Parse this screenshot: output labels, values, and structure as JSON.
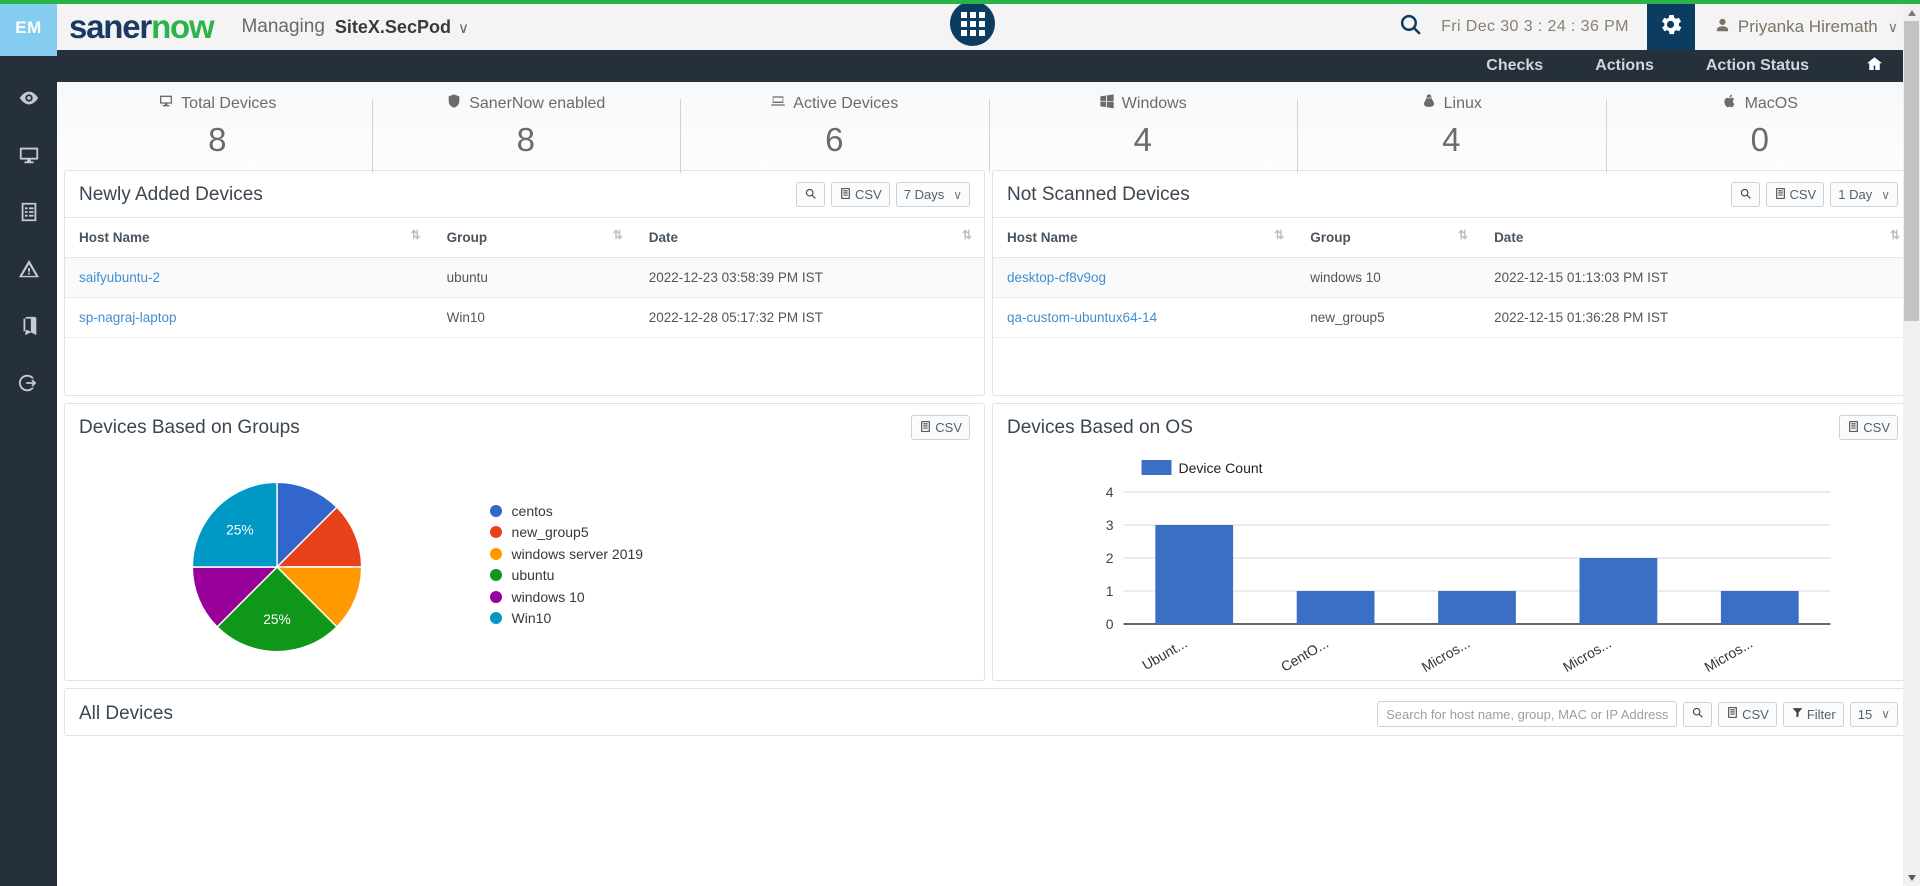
{
  "brand": {
    "part1": "saner",
    "part2": "now"
  },
  "header": {
    "managing_label": "Managing",
    "site": "SiteX.SecPod",
    "chevron": "∨",
    "datetime": "Fri Dec 30  3 : 24 : 36 PM",
    "user_name": "Priyanka Hiremath",
    "search_icon": "search-icon",
    "gear_icon": "gear-icon",
    "apps_icon": "apps-grid-icon"
  },
  "rail": {
    "module_code": "EM",
    "items": [
      {
        "icon": "eye-icon"
      },
      {
        "icon": "monitor-icon"
      },
      {
        "icon": "report-list-icon"
      },
      {
        "icon": "warning-triangle-icon"
      },
      {
        "icon": "book-icon"
      },
      {
        "icon": "logout-icon"
      }
    ]
  },
  "nav": {
    "items": [
      {
        "label": "Checks"
      },
      {
        "label": "Actions"
      },
      {
        "label": "Action Status"
      }
    ],
    "home_icon": "home-icon"
  },
  "stats": [
    {
      "label": "Total Devices",
      "value": "8",
      "icon": "monitor-icon"
    },
    {
      "label": "SanerNow enabled",
      "value": "8",
      "icon": "shield-icon"
    },
    {
      "label": "Active Devices",
      "value": "6",
      "icon": "laptop-icon"
    },
    {
      "label": "Windows",
      "value": "4",
      "icon": "windows-icon"
    },
    {
      "label": "Linux",
      "value": "4",
      "icon": "linux-icon"
    },
    {
      "label": "MacOS",
      "value": "0",
      "icon": "apple-icon"
    }
  ],
  "newly_added": {
    "title": "Newly Added Devices",
    "search_icon": "search-icon",
    "csv_label": "CSV",
    "range_value": "7 Days",
    "columns": [
      "Host Name",
      "Group",
      "Date"
    ],
    "rows": [
      {
        "host": "saifyubuntu-2",
        "group": "ubuntu",
        "date": "2022-12-23 03:58:39 PM IST"
      },
      {
        "host": "sp-nagraj-laptop",
        "group": "Win10",
        "date": "2022-12-28 05:17:32 PM IST"
      }
    ]
  },
  "not_scanned": {
    "title": "Not Scanned Devices",
    "search_icon": "search-icon",
    "csv_label": "CSV",
    "range_value": "1 Day",
    "columns": [
      "Host Name",
      "Group",
      "Date"
    ],
    "rows": [
      {
        "host": "desktop-cf8v9og",
        "group": "windows 10",
        "date": "2022-12-15 01:13:03 PM IST"
      },
      {
        "host": "qa-custom-ubuntux64-14",
        "group": "new_group5",
        "date": "2022-12-15 01:36:28 PM IST"
      }
    ]
  },
  "groups_panel": {
    "title": "Devices Based on Groups",
    "csv_label": "CSV"
  },
  "os_panel": {
    "title": "Devices Based on OS",
    "csv_label": "CSV"
  },
  "all_devices": {
    "title": "All Devices",
    "search_placeholder": "Search for host name, group, MAC or IP Address",
    "search_value": "",
    "search_icon": "search-icon",
    "csv_label": "CSV",
    "filter_label": "Filter",
    "page_size": "15"
  },
  "chart_data": [
    {
      "type": "pie",
      "title": "Devices Based on Groups",
      "legend_position": "right",
      "categories": [
        "centos",
        "new_group5",
        "windows server 2019",
        "ubuntu",
        "windows 10",
        "Win10"
      ],
      "values": [
        12.5,
        12.5,
        12.5,
        25,
        12.5,
        25
      ],
      "labels": [
        "",
        "",
        "",
        "25%",
        "",
        "25%"
      ],
      "colors": [
        "#3366cc",
        "#e8421b",
        "#ff9900",
        "#109618",
        "#990099",
        "#0099c6"
      ]
    },
    {
      "type": "bar",
      "title": "Devices Based on OS",
      "categories": [
        "Ubunt...",
        "CentO...",
        "Micros...",
        "Micros...",
        "Micros..."
      ],
      "values": [
        3,
        1,
        1,
        2,
        1
      ],
      "series": [
        {
          "name": "Device Count",
          "values": [
            3,
            1,
            1,
            2,
            1
          ]
        }
      ],
      "legend": [
        "Device Count"
      ],
      "ylim": [
        0,
        4
      ],
      "yticks": [
        0,
        1,
        2,
        3,
        4
      ],
      "xlabel": "",
      "ylabel": "",
      "grid": true,
      "color": "#3b6fc4"
    }
  ]
}
